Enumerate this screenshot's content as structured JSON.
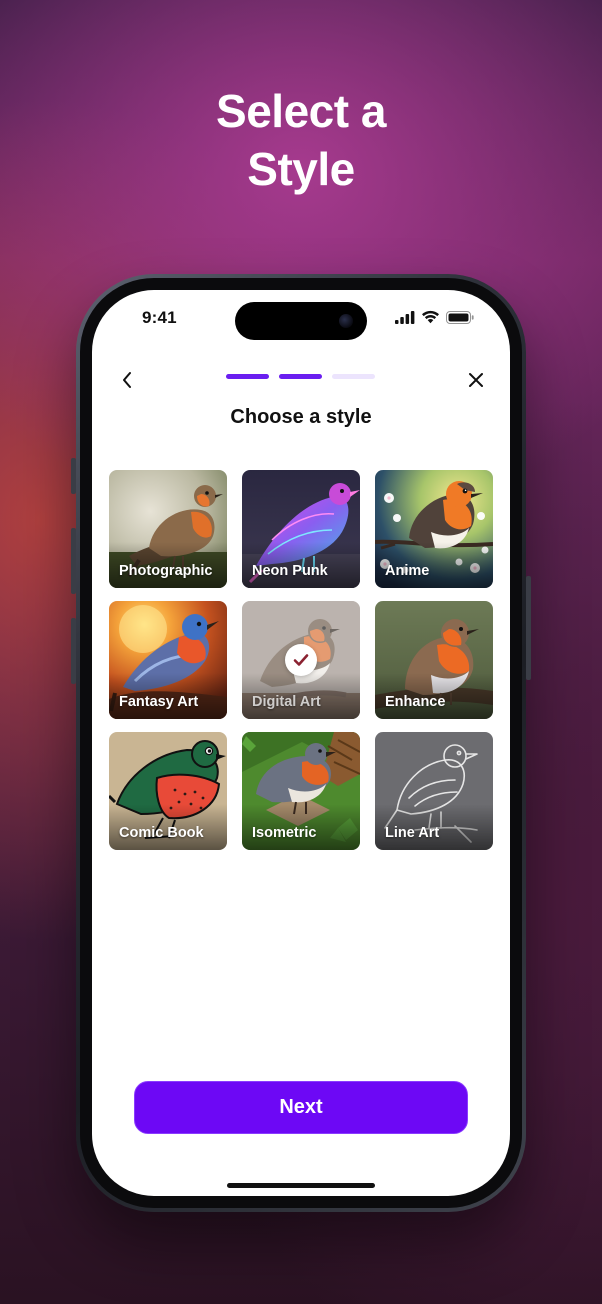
{
  "hero": {
    "line1": "Select a",
    "line2": "Style"
  },
  "status_bar": {
    "time": "9:41",
    "icons": [
      "signal-icon",
      "wifi-icon",
      "battery-icon"
    ]
  },
  "nav": {
    "back_icon": "chevron-left-icon",
    "close_icon": "close-icon",
    "progress": {
      "total_steps": 3,
      "completed_steps": 2
    }
  },
  "screen": {
    "title": "Choose a style"
  },
  "styles": [
    {
      "label": "Photographic",
      "selected": false
    },
    {
      "label": "Neon Punk",
      "selected": false
    },
    {
      "label": "Anime",
      "selected": false
    },
    {
      "label": "Fantasy Art",
      "selected": false
    },
    {
      "label": "Digital Art",
      "selected": true
    },
    {
      "label": "Enhance",
      "selected": false
    },
    {
      "label": "Comic Book",
      "selected": false
    },
    {
      "label": "Isometric",
      "selected": false
    },
    {
      "label": "Line Art",
      "selected": false
    }
  ],
  "actions": {
    "next_label": "Next"
  },
  "colors": {
    "accent": "#6d08f5",
    "progress_active": "#6a1ef0",
    "progress_inactive": "#ece4fd",
    "selected_check": "#8b2231"
  }
}
